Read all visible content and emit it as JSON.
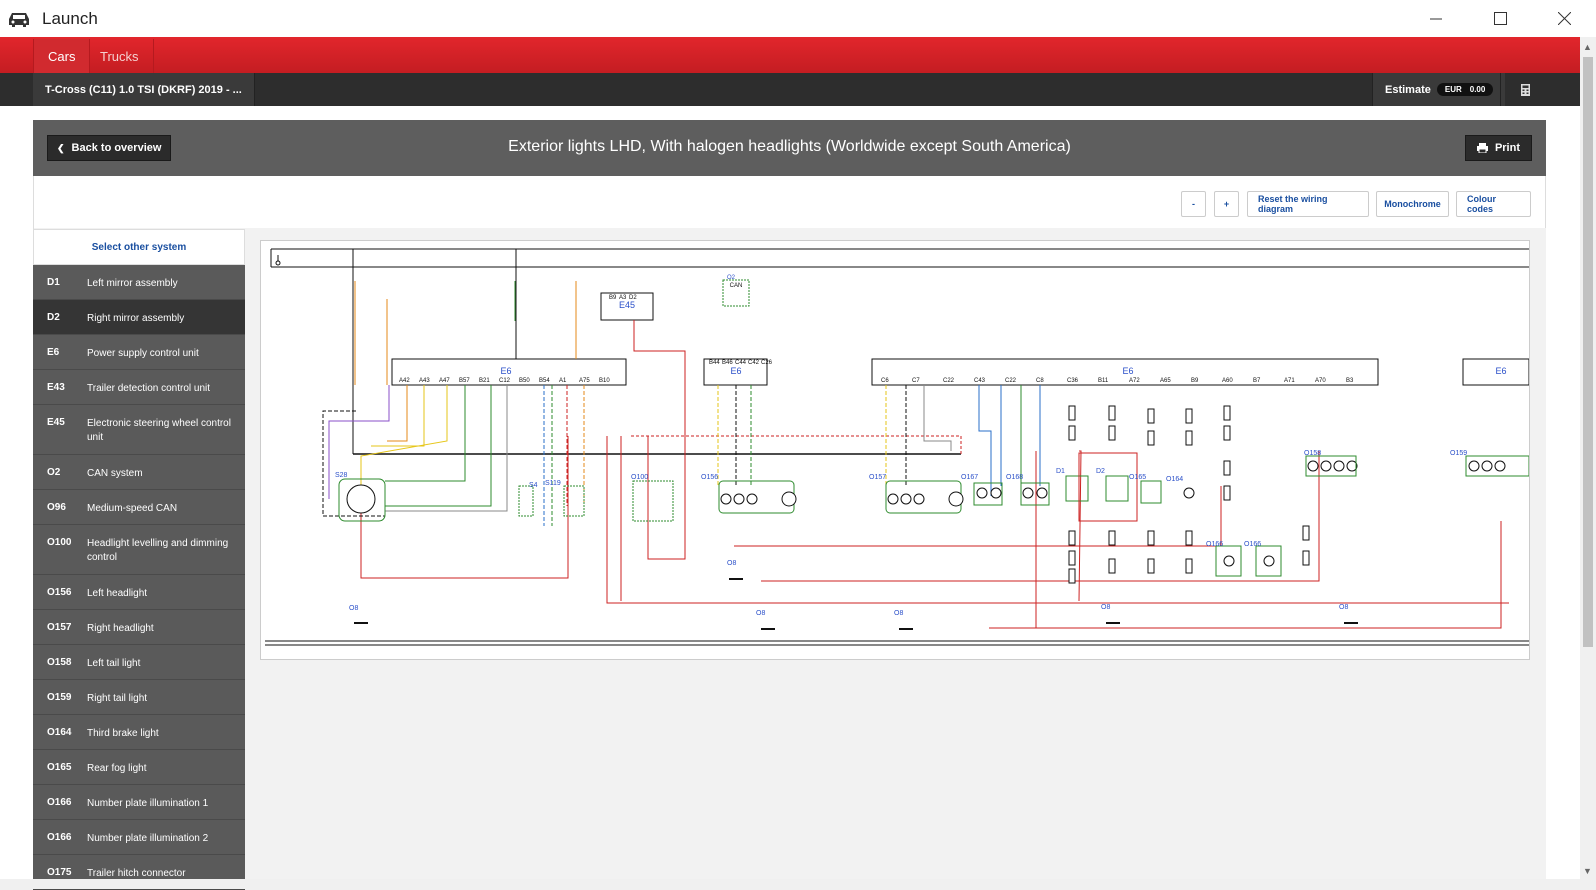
{
  "window": {
    "title": "Launch",
    "icon": "car-icon"
  },
  "nav": {
    "tabs": [
      {
        "label": "Cars",
        "active": true
      },
      {
        "label": "Trucks",
        "active": false
      }
    ]
  },
  "vehicle": {
    "name": "T-Cross (C11) 1.0 TSI (DKRF) 2019 - ..."
  },
  "estimate": {
    "label": "Estimate",
    "currency": "EUR",
    "amount": "0.00"
  },
  "panel": {
    "back_label": "Back to overview",
    "title": "Exterior lights LHD, With halogen headlights (Worldwide except South America)",
    "print_label": "Print"
  },
  "toolbar": {
    "zoom_out": "-",
    "zoom_in": "+",
    "reset": "Reset the wiring diagram",
    "monochrome": "Monochrome",
    "colour_codes": "Colour codes"
  },
  "sidebar": {
    "header": "Select other system",
    "items": [
      {
        "code": "D1",
        "label": "Left mirror assembly"
      },
      {
        "code": "D2",
        "label": "Right mirror assembly",
        "active": true
      },
      {
        "code": "E6",
        "label": "Power supply control unit"
      },
      {
        "code": "E43",
        "label": "Trailer detection control unit"
      },
      {
        "code": "E45",
        "label": "Electronic steering wheel control unit"
      },
      {
        "code": "O2",
        "label": "CAN system"
      },
      {
        "code": "O96",
        "label": "Medium-speed CAN"
      },
      {
        "code": "O100",
        "label": "Headlight levelling and dimming control"
      },
      {
        "code": "O156",
        "label": "Left headlight"
      },
      {
        "code": "O157",
        "label": "Right headlight"
      },
      {
        "code": "O158",
        "label": "Left tail light"
      },
      {
        "code": "O159",
        "label": "Right tail light"
      },
      {
        "code": "O164",
        "label": "Third brake light"
      },
      {
        "code": "O165",
        "label": "Rear fog light"
      },
      {
        "code": "O166",
        "label": "Number plate illumination 1"
      },
      {
        "code": "O166",
        "label": "Number plate illumination 2"
      },
      {
        "code": "O175",
        "label": "Trailer hitch connector"
      }
    ]
  },
  "diagram": {
    "labels": [
      "E6",
      "E6",
      "E6",
      "E6",
      "E45",
      "O2",
      "CAN",
      "S28",
      "S4",
      "S119",
      "O100",
      "O156",
      "O157",
      "O167",
      "O168",
      "D1",
      "D2",
      "O165",
      "O164",
      "O166",
      "O166",
      "O158",
      "O159",
      "O8",
      "O8",
      "O8",
      "O8",
      "O8",
      "O8"
    ],
    "pins_e6_left": [
      "A42",
      "A43",
      "A47",
      "B57",
      "B21",
      "C12",
      "B50",
      "B54",
      "A1",
      "A75",
      "B10"
    ],
    "pins_e6_mid": [
      "B44",
      "B46",
      "C44",
      "C42",
      "C26"
    ],
    "pins_e6_right": [
      "C6",
      "C7",
      "C22",
      "C43",
      "C22",
      "C8",
      "C36",
      "B11",
      "A72",
      "A65",
      "B9",
      "A60",
      "B7",
      "A71",
      "A70",
      "B3"
    ],
    "pins_e45": [
      "B9",
      "A3",
      "D2"
    ],
    "colors": {
      "red": "#cc2222",
      "green": "#2e8b2e",
      "yellow": "#e6c619",
      "orange": "#e68a1a",
      "purple": "#8a4fc9",
      "blue": "#2a6fc9",
      "black": "#111111",
      "grey": "#888888"
    }
  }
}
